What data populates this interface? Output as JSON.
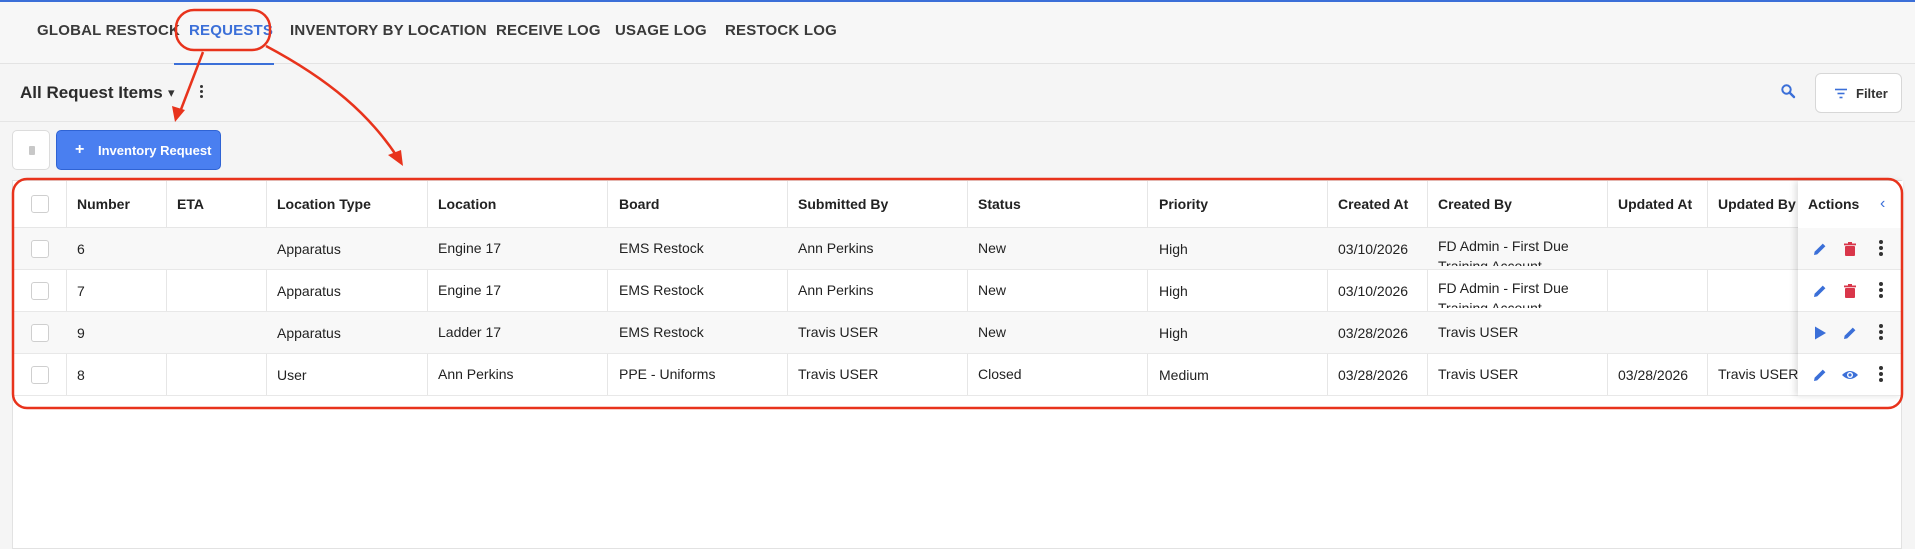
{
  "tabs": [
    {
      "label": "GLOBAL RESTOCK",
      "active": false
    },
    {
      "label": "REQUESTS",
      "active": true
    },
    {
      "label": "INVENTORY BY LOCATION",
      "active": false
    },
    {
      "label": "RECEIVE LOG",
      "active": false
    },
    {
      "label": "USAGE LOG",
      "active": false
    },
    {
      "label": "RESTOCK LOG",
      "active": false
    }
  ],
  "toolbar": {
    "view_title": "All Request Items",
    "filter_label": "Filter"
  },
  "actions": {
    "new_request_label": "Inventory Request"
  },
  "table": {
    "columns": [
      "Number",
      "ETA",
      "Location Type",
      "Location",
      "Board",
      "Submitted By",
      "Status",
      "Priority",
      "Created At",
      "Created By",
      "Updated At",
      "Updated By"
    ],
    "actions_header": "Actions",
    "rows": [
      {
        "number": "6",
        "eta": "",
        "location_type": "Apparatus",
        "location": "Engine 17",
        "board": "EMS Restock",
        "submitted_by": "Ann Perkins",
        "status": "New",
        "priority": "High",
        "created_at": "03/10/2026",
        "created_by": "FD Admin - First Due Training Account",
        "updated_at": "",
        "updated_by": "",
        "actions": [
          "edit-icon",
          "delete-icon",
          "more-icon"
        ]
      },
      {
        "number": "7",
        "eta": "",
        "location_type": "Apparatus",
        "location": "Engine 17",
        "board": "EMS Restock",
        "submitted_by": "Ann Perkins",
        "status": "New",
        "priority": "High",
        "created_at": "03/10/2026",
        "created_by": "FD Admin - First Due Training Account",
        "updated_at": "",
        "updated_by": "",
        "actions": [
          "edit-icon",
          "delete-icon",
          "more-icon"
        ]
      },
      {
        "number": "9",
        "eta": "",
        "location_type": "Apparatus",
        "location": "Ladder 17",
        "board": "EMS Restock",
        "submitted_by": "Travis USER",
        "status": "New",
        "priority": "High",
        "created_at": "03/28/2026",
        "created_by": "Travis USER",
        "updated_at": "",
        "updated_by": "",
        "actions": [
          "play-icon",
          "edit-icon",
          "more-icon"
        ]
      },
      {
        "number": "8",
        "eta": "",
        "location_type": "User",
        "location": "Ann Perkins",
        "board": "PPE - Uniforms",
        "submitted_by": "Travis USER",
        "status": "Closed",
        "priority": "Medium",
        "created_at": "03/28/2026",
        "created_by": "Travis USER",
        "updated_at": "03/28/2026",
        "updated_by": "Travis USER",
        "actions": [
          "edit-icon",
          "view-icon",
          "more-icon"
        ]
      }
    ]
  },
  "colors": {
    "accent": "#3b6fd8",
    "primary_button": "#4a7ff0",
    "delete": "#d9364a",
    "annotation": "#e8331c"
  }
}
